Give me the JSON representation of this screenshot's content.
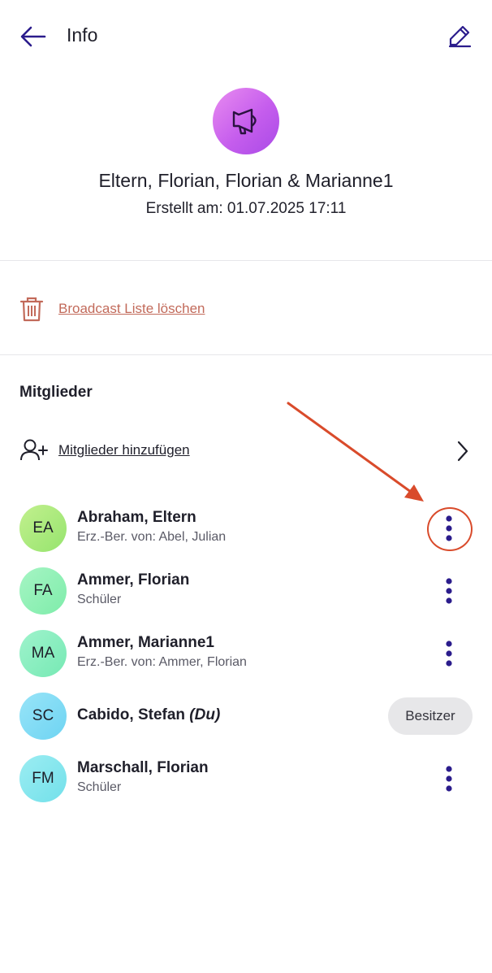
{
  "header": {
    "title": "Info",
    "back_icon": "arrow-left-icon",
    "edit_icon": "edit-pencil-icon"
  },
  "broadcast": {
    "icon": "megaphone-icon",
    "name": "Eltern, Florian, Florian & Marianne1",
    "created_label": "Erstellt am:",
    "created_value": "01.07.2025 17:11"
  },
  "actions": {
    "delete_label": "Broadcast Liste löschen",
    "delete_icon": "trash-icon"
  },
  "members": {
    "section_title": "Mitglieder",
    "add_label": "Mitglieder hinzufügen",
    "add_icon": "add-user-icon",
    "list": [
      {
        "initials": "EA",
        "name": "Abraham, Eltern",
        "sub": "Erz.-Ber. von: Abel, Julian",
        "color": "#a8ea7e"
      },
      {
        "initials": "FA",
        "name": "Ammer, Florian",
        "sub": "Schüler",
        "color": "#8ff0b3"
      },
      {
        "initials": "MA",
        "name": "Ammer, Marianne1",
        "sub": "Erz.-Ber. von: Ammer, Florian",
        "color": "#86efbe"
      },
      {
        "initials": "SC",
        "name": "Cabido, Stefan",
        "name_suffix": "(Du)",
        "sub": "",
        "badge": "Besitzer",
        "color": "#7fdcf5"
      },
      {
        "initials": "FM",
        "name": "Marschall, Florian",
        "sub": "Schüler",
        "color": "#84e7ef"
      }
    ]
  },
  "colors": {
    "accent": "#2b1c8c",
    "danger": "#c26a5a",
    "annotation": "#d94b2b"
  }
}
